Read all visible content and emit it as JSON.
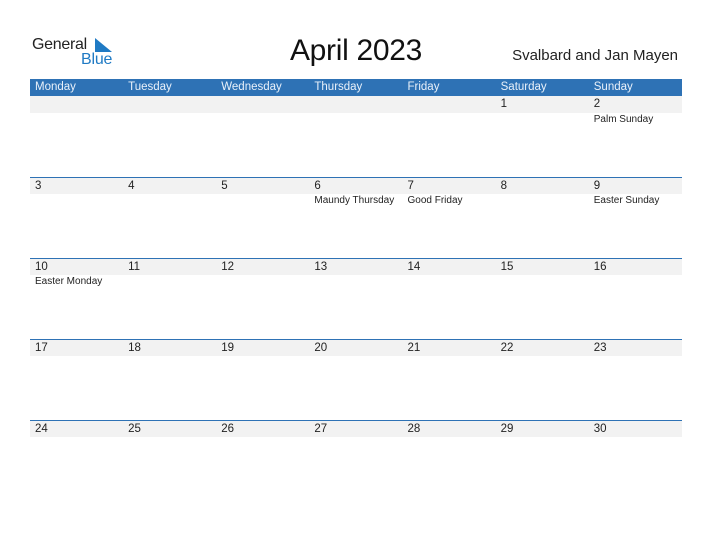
{
  "logo": {
    "word1": "General",
    "word2": "Blue"
  },
  "header": {
    "title": "April 2023",
    "region": "Svalbard and Jan Mayen"
  },
  "colors": {
    "accent": "#2e72b5",
    "strip": "#f2f2f2",
    "logo_blue": "#1f7ac4"
  },
  "weekdays": [
    "Monday",
    "Tuesday",
    "Wednesday",
    "Thursday",
    "Friday",
    "Saturday",
    "Sunday"
  ],
  "weeks": [
    {
      "days": [
        "",
        "",
        "",
        "",
        "",
        "1",
        "2"
      ],
      "holidays": [
        "",
        "",
        "",
        "",
        "",
        "",
        "Palm Sunday"
      ]
    },
    {
      "days": [
        "3",
        "4",
        "5",
        "6",
        "7",
        "8",
        "9"
      ],
      "holidays": [
        "",
        "",
        "",
        "Maundy Thursday",
        "Good Friday",
        "",
        "Easter Sunday"
      ]
    },
    {
      "days": [
        "10",
        "11",
        "12",
        "13",
        "14",
        "15",
        "16"
      ],
      "holidays": [
        "Easter Monday",
        "",
        "",
        "",
        "",
        "",
        ""
      ]
    },
    {
      "days": [
        "17",
        "18",
        "19",
        "20",
        "21",
        "22",
        "23"
      ],
      "holidays": [
        "",
        "",
        "",
        "",
        "",
        "",
        ""
      ]
    },
    {
      "days": [
        "24",
        "25",
        "26",
        "27",
        "28",
        "29",
        "30"
      ],
      "holidays": [
        "",
        "",
        "",
        "",
        "",
        "",
        ""
      ]
    }
  ]
}
